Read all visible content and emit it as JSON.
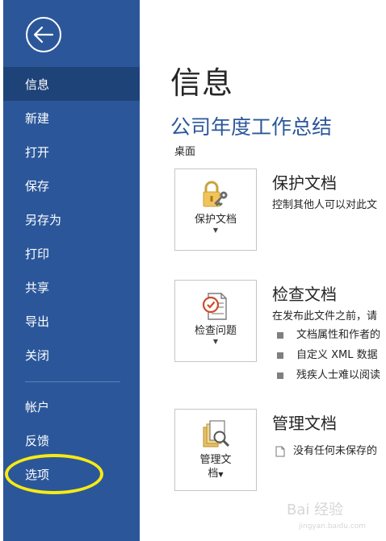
{
  "sidebar": {
    "items": [
      {
        "label": "信息"
      },
      {
        "label": "新建"
      },
      {
        "label": "打开"
      },
      {
        "label": "保存"
      },
      {
        "label": "另存为"
      },
      {
        "label": "打印"
      },
      {
        "label": "共享"
      },
      {
        "label": "导出"
      },
      {
        "label": "关闭"
      },
      {
        "label": "帐户"
      },
      {
        "label": "反馈"
      },
      {
        "label": "选项"
      }
    ]
  },
  "main": {
    "page_title": "信息",
    "doc_title": "公司年度工作总结",
    "doc_location": "桌面",
    "protect": {
      "tile_label": "保护文档",
      "heading": "保护文档",
      "description": "控制其他人可以对此文"
    },
    "inspect": {
      "tile_label": "检查问题",
      "heading": "检查文档",
      "description": "在发布此文件之前，请",
      "bullets": [
        "文档属性和作者的",
        "自定义 XML 数据",
        "残疾人士难以阅读"
      ]
    },
    "manage": {
      "tile_label_line1": "管理文",
      "tile_label_line2": "档",
      "heading": "管理文档",
      "line": "没有任何未保存的"
    }
  },
  "watermark": {
    "text": "Bai 经验",
    "sub": "jingyan.baidu.com"
  },
  "colors": {
    "sidebar": "#2b579a",
    "active": "#1e4379",
    "accent": "#2b579a",
    "highlight": "#f7ea13"
  }
}
